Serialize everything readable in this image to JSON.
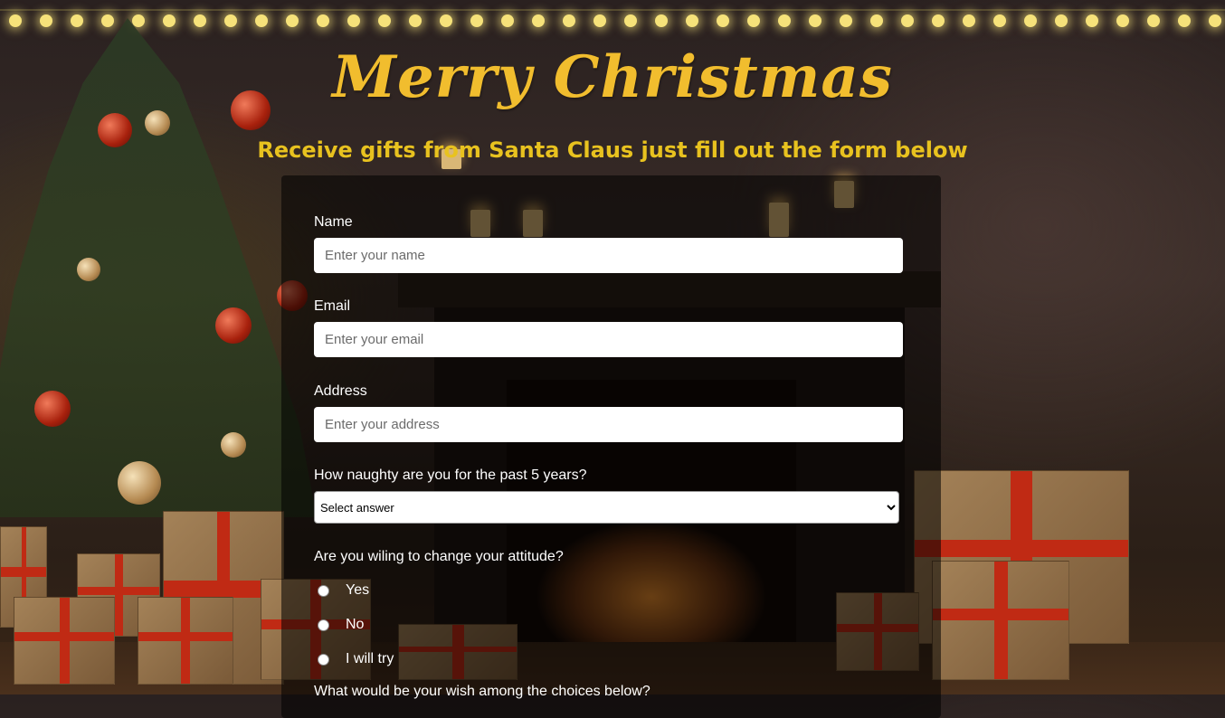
{
  "header": {
    "title": "Merry Christmas",
    "subtitle": "Receive gifts from Santa Claus just fill out the form below"
  },
  "form": {
    "name": {
      "label": "Name",
      "placeholder": "Enter your name"
    },
    "email": {
      "label": "Email",
      "placeholder": "Enter your email"
    },
    "address": {
      "label": "Address",
      "placeholder": "Enter your address"
    },
    "naughty": {
      "label": "How naughty are you for the past 5 years?",
      "selected": "Select answer"
    },
    "attitude": {
      "label": "Are you wiling to change your attitude?",
      "options": [
        "Yes",
        "No",
        "I will try"
      ]
    },
    "wish": {
      "label": "What would be your wish among the choices below?"
    }
  },
  "colors": {
    "title": "#f1bd2e",
    "subtitle": "#e8c21f",
    "panel": "rgba(0,0,0,0.55)"
  }
}
